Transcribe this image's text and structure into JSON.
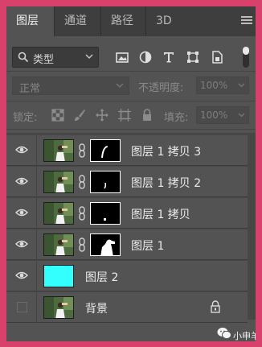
{
  "tabs": [
    {
      "label": "图层",
      "active": true
    },
    {
      "label": "通道",
      "active": false
    },
    {
      "label": "路径",
      "active": false
    },
    {
      "label": "3D",
      "active": false
    }
  ],
  "filter": {
    "kind_label": "类型",
    "icons": [
      "image-filter-icon",
      "adjustment-filter-icon",
      "type-filter-icon",
      "shape-filter-icon",
      "smart-object-filter-icon"
    ]
  },
  "blend": {
    "mode": "正常",
    "opacity_label": "不透明度:",
    "opacity_value": "100%"
  },
  "lock": {
    "label": "锁定:",
    "icons": [
      "lock-transparent-pixels-icon",
      "lock-image-pixels-icon",
      "lock-position-icon",
      "lock-artboard-icon",
      "lock-all-icon"
    ],
    "fill_label": "填充:",
    "fill_value": "100%"
  },
  "layers": [
    {
      "name": "图层 1 拷贝 3",
      "visible": true,
      "thumb": "photo",
      "mask": "stroke"
    },
    {
      "name": "图层 1 拷贝 2",
      "visible": true,
      "thumb": "photo",
      "mask": "small-stroke"
    },
    {
      "name": "图层 1 拷贝",
      "visible": true,
      "thumb": "photo",
      "mask": "dot"
    },
    {
      "name": "图层 1",
      "visible": true,
      "thumb": "photo",
      "mask": "silhouette"
    },
    {
      "name": "图层 2",
      "visible": true,
      "thumb": "fill",
      "fill_color": "#33ffff"
    },
    {
      "name": "背景",
      "visible": false,
      "thumb": "photo",
      "locked": true
    }
  ],
  "watermark": {
    "text": "小申羊"
  },
  "colors": {
    "accent_frame": "#d8416c",
    "layer_fill": "#33ffff"
  }
}
